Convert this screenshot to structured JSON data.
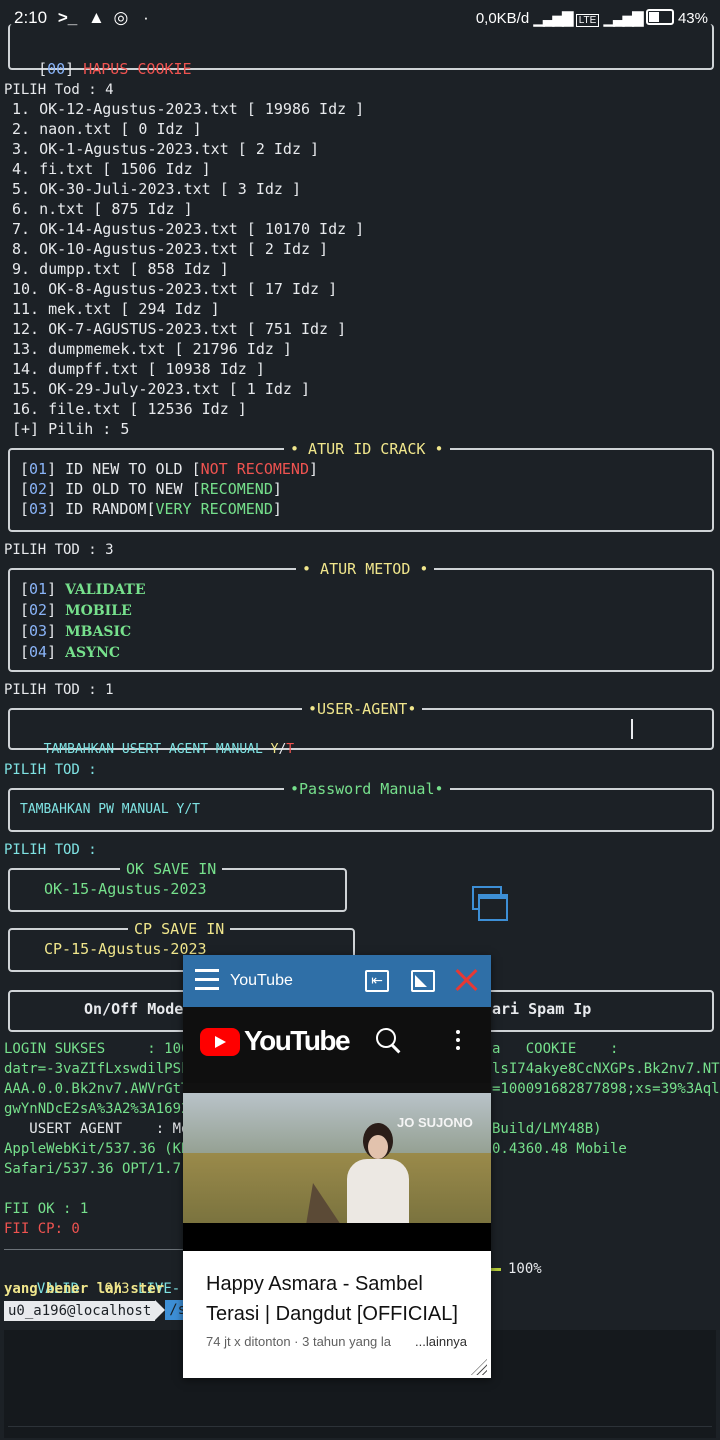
{
  "status_bar": {
    "time": "2:10",
    "left_icons": [
      "terminal-prompt-icon",
      "warning-icon",
      "whatsapp-icon",
      "dot-icon"
    ],
    "net_speed": "0,0KB/d",
    "battery": "43%"
  },
  "terminal": {
    "top_menu_item": {
      "num": "00",
      "label": "HAPUS COOKIE"
    },
    "prompt1": "PILIH Tod : 4",
    "files": [
      "1. OK-12-Agustus-2023.txt [ 19986 Idz ]",
      "2. naon.txt [ 0 Idz ]",
      "3. OK-1-Agustus-2023.txt [ 2 Idz ]",
      "4. fi.txt [ 1506 Idz ]",
      "5. OK-30-Juli-2023.txt [ 3 Idz ]",
      "6. n.txt [ 875 Idz ]",
      "7. OK-14-Agustus-2023.txt [ 10170 Idz ]",
      "8. OK-10-Agustus-2023.txt [ 2 Idz ]",
      "9. dumpp.txt [ 858 Idz ]",
      "10. OK-8-Agustus-2023.txt [ 17 Idz ]",
      "11. mek.txt [ 294 Idz ]",
      "12. OK-7-AGUSTUS-2023.txt [ 751 Idz ]",
      "13. dumpmemek.txt [ 21796 Idz ]",
      "14. dumpff.txt [ 10938 Idz ]",
      "15. OK-29-July-2023.txt [ 1 Idz ]",
      "16. file.txt [ 12536 Idz ]"
    ],
    "pilih": "[+] Pilih : 5",
    "atur_id": {
      "title": "• ATUR ID CRACK •",
      "items": [
        {
          "num": "01",
          "label": "ID NEW TO OLD ",
          "tag": "NOT RECOMEND"
        },
        {
          "num": "02",
          "label": "ID OLD TO NEW ",
          "tag": "RECOMEND"
        },
        {
          "num": "03",
          "label": "ID RANDOM",
          "tag": "VERY RECOMEND"
        }
      ]
    },
    "prompt2": "PILIH TOD : 3",
    "atur_metod": {
      "title": "• ATUR METOD •",
      "items": [
        {
          "num": "01",
          "label": "VALIDATE"
        },
        {
          "num": "02",
          "label": "MOBILE"
        },
        {
          "num": "03",
          "label": "MBASIC"
        },
        {
          "num": "04",
          "label": "ASYNC"
        }
      ]
    },
    "prompt3": "PILIH TOD : 1",
    "user_agent": {
      "title": "•USER-AGENT•",
      "text": "TAMBAHKAN USERT AGENT MANUAL ",
      "y": "Y",
      "slash": "/",
      "t": "T"
    },
    "prompt4": "PILIH TOD :",
    "password": {
      "title": "•Password Manual•",
      "text": "TAMBAHKAN PW MANUAL Y/T"
    },
    "prompt5": "PILIH TOD :",
    "ok_save": {
      "title": "OK SAVE IN",
      "value": "OK-15-Agustus-2023"
    },
    "cp_save": {
      "title": "CP SAVE IN",
      "value": "CP-15-Agustus-2023"
    },
    "mode_left": "On/Off Mode ",
    "mode_right": "ari Spam Ip",
    "login_line": "LOGIN SUKSES     : 1000",
    "cookie_label": "a   COOKIE    :",
    "cookie_l1": "datr=-3vaZIfLxswdilPSk",
    "cookie_r1": "lsI74akye8CcNXGPs.Bk2nv7.NT.",
    "cookie_l2": "AAA.0.0.Bk2nv7.AWVrGtT",
    "cookie_r2": "=100091682877898;xs=39%3AqlK",
    "cookie_l3": "gwYnNDcE2sA%3A2%3A1692",
    "ua_label": "   USERT AGENT    : Moz",
    "ua_r1": "Build/LMY48B)",
    "ua_l2": "AppleWebKit/537.36 (KH",
    "ua_r2": "0.4360.48 Mobile",
    "ua_l3": "Safari/537.36 OPT/1.7.",
    "fii_ok": "FII OK : 1",
    "fii_cp": "FII CP: 0",
    "valid": "VALID",
    "valid_count": "0/3",
    "live": "LIVE-:0",
    "live_frag": "c",
    "percent": "100%",
    "msg": "yang bener lah ster",
    "prompt_user": "u0_a196@localhost",
    "prompt_path": "/s"
  },
  "youtube_popup": {
    "app_name": "YouTube",
    "logo_text": "YouTube",
    "thumb_caption": "JO SUJONO",
    "video_title": "Happy Asmara - Sambel Terasi | Dangdut [OFFICIAL]",
    "meta": "74 jt x ditonton · 3 tahun yang la",
    "more": "...lainnya"
  },
  "colors": {
    "bg": "#1c2126",
    "red": "#ef5350",
    "green": "#76e08c",
    "yellow": "#f0e68c",
    "yt_bar": "#2f6fa7"
  }
}
